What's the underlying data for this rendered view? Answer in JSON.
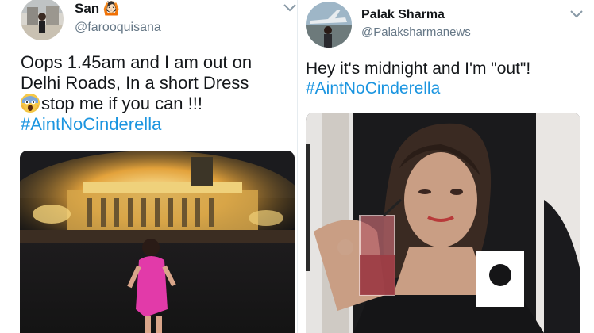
{
  "tweets": [
    {
      "name": "San",
      "name_suffix": "🙆🏻",
      "handle": "@farooquisana",
      "lines": [
        "Oops 1.45am and I am out on",
        "Delhi Roads, In a short Dress",
        "stop me if you can !!!"
      ],
      "hashtag": "#AintNoCinderella"
    },
    {
      "name": "Palak Sharma",
      "handle": "@Palaksharmanews",
      "lines": [
        "Hey it's midnight and I'm \"out\"!"
      ],
      "hashtag": "#AintNoCinderella"
    }
  ],
  "icons": {
    "more": "chevron-down-icon",
    "emoji": "screaming-face-emoji"
  },
  "colors": {
    "hashtag": "#1b95e0",
    "handle": "#657786",
    "text": "#14171a"
  }
}
